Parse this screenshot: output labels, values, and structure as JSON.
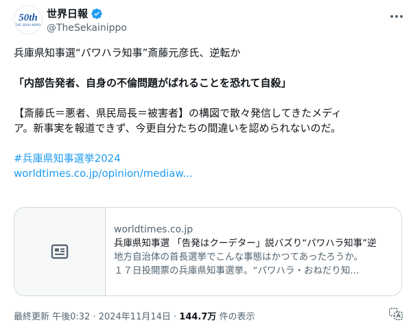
{
  "author": {
    "avatar_text": "50th",
    "avatar_sub": "THE SEKAI NIPPO",
    "name": "世界日報",
    "handle": "@TheSekainippo"
  },
  "tweet": {
    "line1": "兵庫県知事選“パワハラ知事”斎藤元彦氏、逆転か",
    "line2": "「内部告発者、自身の不倫問題がばれることを恐れて自殺」",
    "line3": "【斎藤氏＝悪者、県民局長＝被害者】の構図で散々発信してきたメディ",
    "line4": "ア。新事実を報道できず、今更自分たちの間違いを認められないのだ。",
    "hashtag": "#兵庫県知事選挙2024",
    "link": "worldtimes.co.jp/opinion/mediaw..."
  },
  "card": {
    "domain": "worldtimes.co.jp",
    "title": "兵庫県知事選 「告発はクーデター」説バズり“パワハラ知事”逆",
    "desc1": "地方自治体の首長選挙でこんな事態はかつてあったろうか。",
    "desc2": "１７日投開票の兵庫県知事選挙。“パワハラ・おねだり知..."
  },
  "meta": {
    "time": "最終更新 午後0:32 · 2024年11月14日 · ",
    "views": "144.7万",
    "views_suffix": " 件の表示"
  },
  "colors": {
    "link": "#1d9bf0",
    "secondary": "#536471",
    "brand": "#1d5aa8"
  },
  "icons": [
    "verified-badge-icon",
    "more-icon",
    "article-icon",
    "translate-icon"
  ]
}
